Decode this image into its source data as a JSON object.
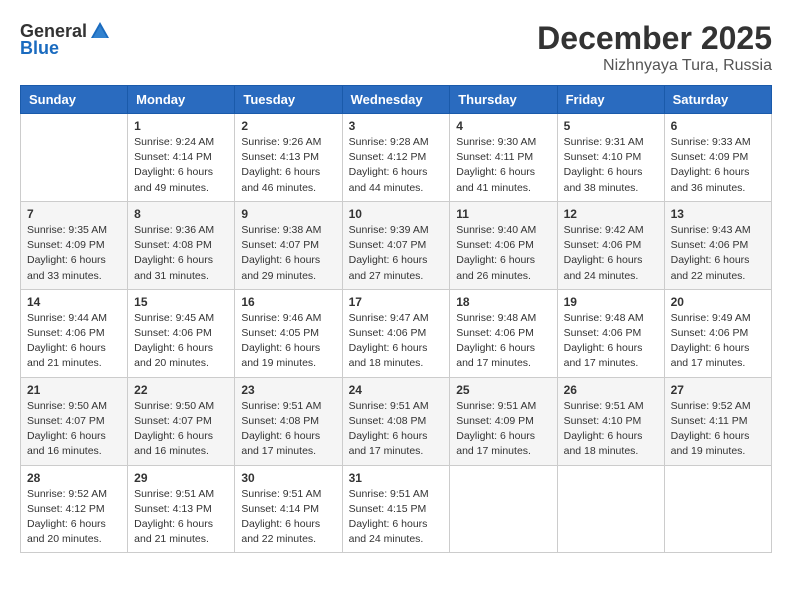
{
  "header": {
    "logo_general": "General",
    "logo_blue": "Blue",
    "month": "December 2025",
    "location": "Nizhnyaya Tura, Russia"
  },
  "weekdays": [
    "Sunday",
    "Monday",
    "Tuesday",
    "Wednesday",
    "Thursday",
    "Friday",
    "Saturday"
  ],
  "weeks": [
    [
      {
        "day": "",
        "info": ""
      },
      {
        "day": "1",
        "info": "Sunrise: 9:24 AM\nSunset: 4:14 PM\nDaylight: 6 hours\nand 49 minutes."
      },
      {
        "day": "2",
        "info": "Sunrise: 9:26 AM\nSunset: 4:13 PM\nDaylight: 6 hours\nand 46 minutes."
      },
      {
        "day": "3",
        "info": "Sunrise: 9:28 AM\nSunset: 4:12 PM\nDaylight: 6 hours\nand 44 minutes."
      },
      {
        "day": "4",
        "info": "Sunrise: 9:30 AM\nSunset: 4:11 PM\nDaylight: 6 hours\nand 41 minutes."
      },
      {
        "day": "5",
        "info": "Sunrise: 9:31 AM\nSunset: 4:10 PM\nDaylight: 6 hours\nand 38 minutes."
      },
      {
        "day": "6",
        "info": "Sunrise: 9:33 AM\nSunset: 4:09 PM\nDaylight: 6 hours\nand 36 minutes."
      }
    ],
    [
      {
        "day": "7",
        "info": "Sunrise: 9:35 AM\nSunset: 4:09 PM\nDaylight: 6 hours\nand 33 minutes."
      },
      {
        "day": "8",
        "info": "Sunrise: 9:36 AM\nSunset: 4:08 PM\nDaylight: 6 hours\nand 31 minutes."
      },
      {
        "day": "9",
        "info": "Sunrise: 9:38 AM\nSunset: 4:07 PM\nDaylight: 6 hours\nand 29 minutes."
      },
      {
        "day": "10",
        "info": "Sunrise: 9:39 AM\nSunset: 4:07 PM\nDaylight: 6 hours\nand 27 minutes."
      },
      {
        "day": "11",
        "info": "Sunrise: 9:40 AM\nSunset: 4:06 PM\nDaylight: 6 hours\nand 26 minutes."
      },
      {
        "day": "12",
        "info": "Sunrise: 9:42 AM\nSunset: 4:06 PM\nDaylight: 6 hours\nand 24 minutes."
      },
      {
        "day": "13",
        "info": "Sunrise: 9:43 AM\nSunset: 4:06 PM\nDaylight: 6 hours\nand 22 minutes."
      }
    ],
    [
      {
        "day": "14",
        "info": "Sunrise: 9:44 AM\nSunset: 4:06 PM\nDaylight: 6 hours\nand 21 minutes."
      },
      {
        "day": "15",
        "info": "Sunrise: 9:45 AM\nSunset: 4:06 PM\nDaylight: 6 hours\nand 20 minutes."
      },
      {
        "day": "16",
        "info": "Sunrise: 9:46 AM\nSunset: 4:05 PM\nDaylight: 6 hours\nand 19 minutes."
      },
      {
        "day": "17",
        "info": "Sunrise: 9:47 AM\nSunset: 4:06 PM\nDaylight: 6 hours\nand 18 minutes."
      },
      {
        "day": "18",
        "info": "Sunrise: 9:48 AM\nSunset: 4:06 PM\nDaylight: 6 hours\nand 17 minutes."
      },
      {
        "day": "19",
        "info": "Sunrise: 9:48 AM\nSunset: 4:06 PM\nDaylight: 6 hours\nand 17 minutes."
      },
      {
        "day": "20",
        "info": "Sunrise: 9:49 AM\nSunset: 4:06 PM\nDaylight: 6 hours\nand 17 minutes."
      }
    ],
    [
      {
        "day": "21",
        "info": "Sunrise: 9:50 AM\nSunset: 4:07 PM\nDaylight: 6 hours\nand 16 minutes."
      },
      {
        "day": "22",
        "info": "Sunrise: 9:50 AM\nSunset: 4:07 PM\nDaylight: 6 hours\nand 16 minutes."
      },
      {
        "day": "23",
        "info": "Sunrise: 9:51 AM\nSunset: 4:08 PM\nDaylight: 6 hours\nand 17 minutes."
      },
      {
        "day": "24",
        "info": "Sunrise: 9:51 AM\nSunset: 4:08 PM\nDaylight: 6 hours\nand 17 minutes."
      },
      {
        "day": "25",
        "info": "Sunrise: 9:51 AM\nSunset: 4:09 PM\nDaylight: 6 hours\nand 17 minutes."
      },
      {
        "day": "26",
        "info": "Sunrise: 9:51 AM\nSunset: 4:10 PM\nDaylight: 6 hours\nand 18 minutes."
      },
      {
        "day": "27",
        "info": "Sunrise: 9:52 AM\nSunset: 4:11 PM\nDaylight: 6 hours\nand 19 minutes."
      }
    ],
    [
      {
        "day": "28",
        "info": "Sunrise: 9:52 AM\nSunset: 4:12 PM\nDaylight: 6 hours\nand 20 minutes."
      },
      {
        "day": "29",
        "info": "Sunrise: 9:51 AM\nSunset: 4:13 PM\nDaylight: 6 hours\nand 21 minutes."
      },
      {
        "day": "30",
        "info": "Sunrise: 9:51 AM\nSunset: 4:14 PM\nDaylight: 6 hours\nand 22 minutes."
      },
      {
        "day": "31",
        "info": "Sunrise: 9:51 AM\nSunset: 4:15 PM\nDaylight: 6 hours\nand 24 minutes."
      },
      {
        "day": "",
        "info": ""
      },
      {
        "day": "",
        "info": ""
      },
      {
        "day": "",
        "info": ""
      }
    ]
  ]
}
